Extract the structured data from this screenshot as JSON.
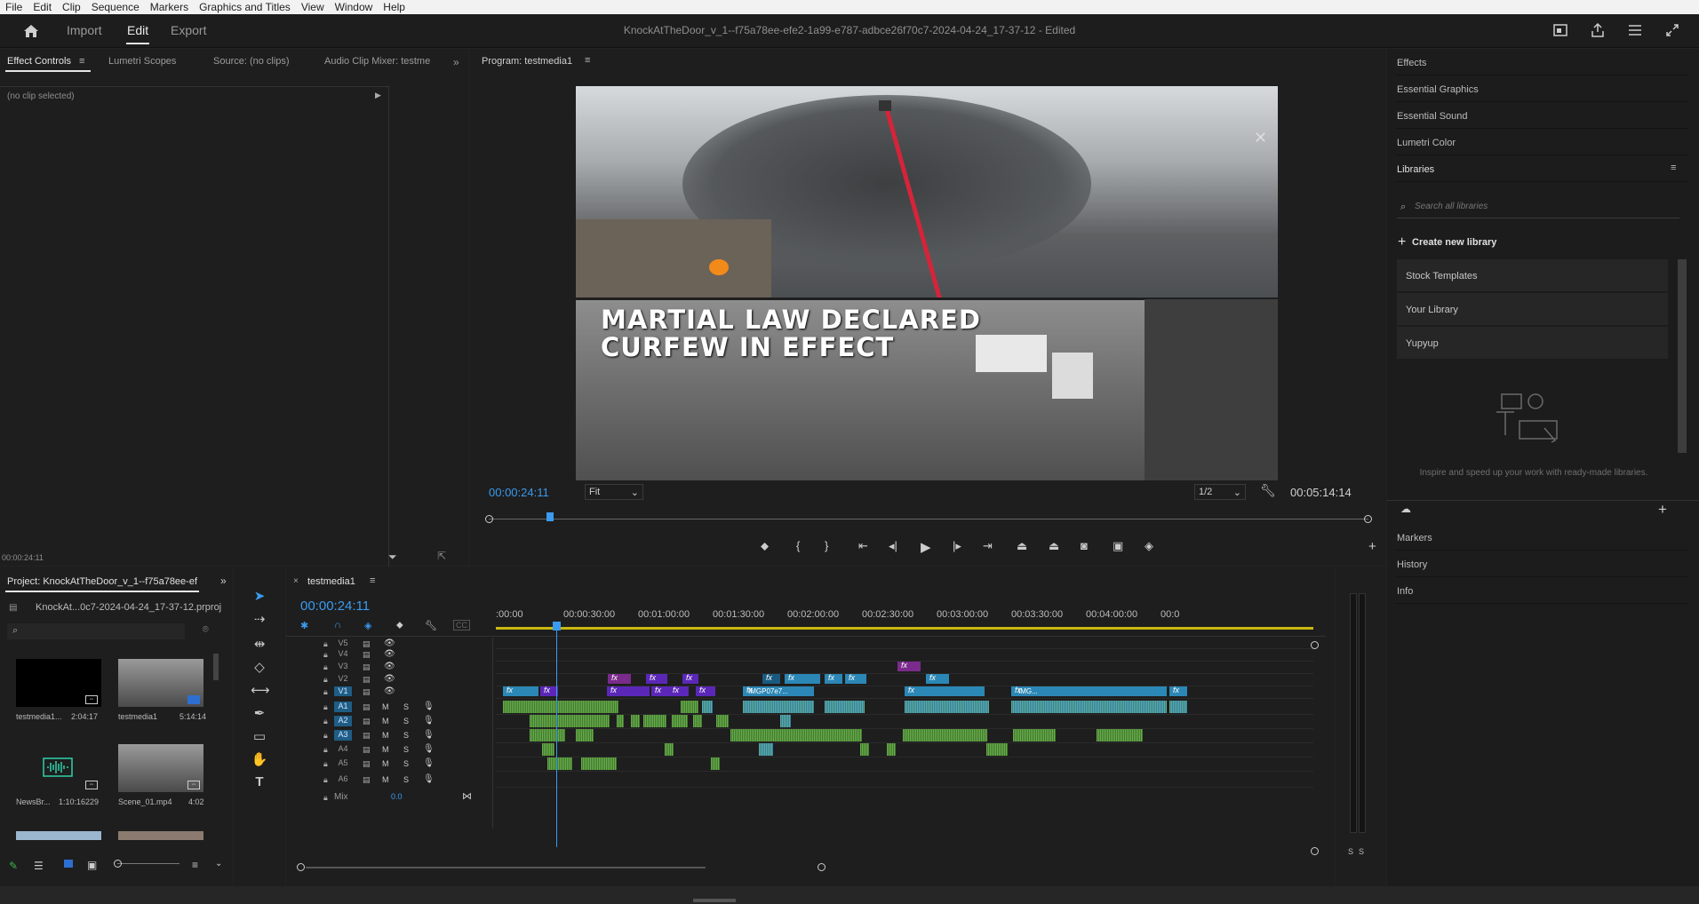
{
  "menu": [
    "File",
    "Edit",
    "Clip",
    "Sequence",
    "Markers",
    "Graphics and Titles",
    "View",
    "Window",
    "Help"
  ],
  "workspace": {
    "tabs": [
      "Import",
      "Edit",
      "Export"
    ],
    "active": "Edit"
  },
  "document": {
    "title": "KnockAtTheDoor_v_1--f75a78ee-efe2-1a99-e787-adbce26f70c7-2024-04-24_17-37-12",
    "status": "- Edited"
  },
  "source_panel": {
    "tabs": [
      "Effect Controls",
      "Lumetri Scopes",
      "Source: (no clips)",
      "Audio Clip Mixer: testme"
    ],
    "no_clip": "(no clip selected)",
    "timecode": "00:00:24:11"
  },
  "program": {
    "tab": "Program: testmedia1",
    "timecode_in": "00:00:24:11",
    "timecode_out": "00:05:14:14",
    "fit": "Fit",
    "resolution": "1/2",
    "overlay": {
      "line1": "MARTIAL LAW DECLARED",
      "line2": "CURFEW IN EFFECT"
    },
    "playhead_pct": 0.07
  },
  "right_panel": {
    "items_top": [
      "Effects",
      "Essential Graphics",
      "Essential Sound",
      "Lumetri Color",
      "Libraries"
    ],
    "search_placeholder": "Search all libraries",
    "create_label": "Create new library",
    "libraries": [
      "Stock Templates",
      "Your Library",
      "Yupyup"
    ],
    "empty_text": "Inspire and speed up your work with ready-made libraries.",
    "items_bottom": [
      "Markers",
      "History",
      "Info"
    ]
  },
  "project": {
    "tab": "Project: KnockAtTheDoor_v_1--f75a78ee-ef",
    "file": "KnockAt...0c7-2024-04-24_17-37-12.prproj",
    "bins": [
      {
        "name": "testmedia1...",
        "duration": "2:04:17"
      },
      {
        "name": "testmedia1",
        "duration": "5:14:14"
      },
      {
        "name": "NewsBr...",
        "duration": "1:10:16229"
      },
      {
        "name": "Scene_01.mp4",
        "duration": "4:02"
      }
    ]
  },
  "timeline": {
    "tab": "testmedia1",
    "timecode": "00:00:24:11",
    "ruler": [
      ":00:00",
      "00:00:30:00",
      "00:01:00:00",
      "00:01:30:00",
      "00:02:00:00",
      "00:02:30:00",
      "00:03:00:00",
      "00:03:30:00",
      "00:04:00:00",
      "00:0"
    ],
    "video_tracks": [
      "V5",
      "V4",
      "V3",
      "V2",
      "V1"
    ],
    "audio_tracks": [
      "A1",
      "A2",
      "A3",
      "A4",
      "A5",
      "A6"
    ],
    "mix_label": "Mix",
    "mix_value": "0.0",
    "clip_labels": {
      "v1a": "IMGP07e7...",
      "v1b": "IMG..."
    },
    "fx": "fx",
    "m": "M",
    "s": "S"
  },
  "meter": {
    "s1": "S",
    "s2": "S"
  },
  "colors": {
    "accent": "#2d8ceb",
    "video": "#2b87b5",
    "audio": "#3f7a2c",
    "purple": "#5b27b8"
  }
}
